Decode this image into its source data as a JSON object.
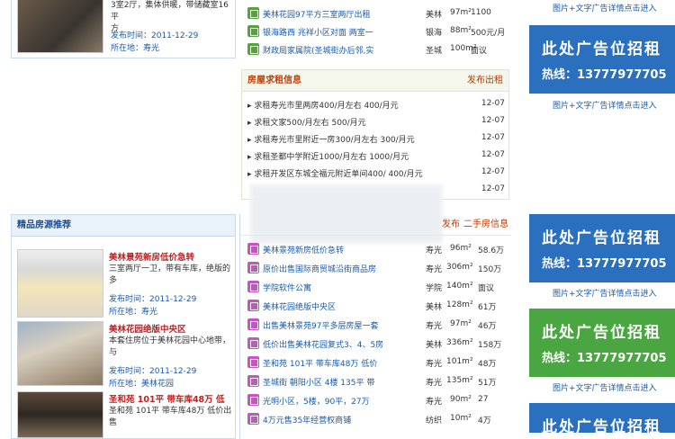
{
  "top_listing": {
    "desc": [
      "3室2厅，集体供暖，带储藏室16平",
      "方"
    ],
    "time": "发布时间：2011-12-29",
    "location": "所在地：寿光"
  },
  "top_rows": [
    {
      "title": "美林花园97平方三室两厅出租",
      "area": "美林",
      "size": "97m²",
      "price": "1100"
    },
    {
      "title": "银海路西 兆祥小区对面 两室一",
      "area": "银海",
      "size": "88m²",
      "price": "500元/月"
    },
    {
      "title": "财政局家属院(圣城街办后邻,实",
      "area": "圣城",
      "size": "100m²",
      "price": "面议"
    }
  ],
  "wanted": {
    "title": "房屋求租信息",
    "action": "发布出租",
    "items": [
      {
        "text": "求租寿光市里两房400/月左右 400/月元",
        "date": "12-07"
      },
      {
        "text": "求租文家500/月左右 500/月元",
        "date": "12-07"
      },
      {
        "text": "求租寿光市里附近一房300/月左右 300/月元",
        "date": "12-07"
      },
      {
        "text": "求租圣都中学附近1000/月左右 1000/月元",
        "date": "12-07"
      },
      {
        "text": "求租开发区东城全福元附近单间400/ 400/月元",
        "date": "12-07"
      },
      {
        "text": "",
        "date": "12-07"
      }
    ]
  },
  "featured": {
    "title": "精品房源推荐",
    "items": [
      {
        "title": "美林景苑新房低价急转",
        "desc": [
          "三室两厅一卫，带有车库，绝版的",
          "多"
        ],
        "time": "发布时间：2011-12-29",
        "location": "所在地：寿光"
      },
      {
        "title": "美林花园绝版中央区",
        "desc": [
          "本套住房位于美林花园中心地带，",
          "与"
        ],
        "time": "发布时间：2011-12-29",
        "location": "所在地：美林花园"
      },
      {
        "title": "圣和苑 101平 带车库48万 低",
        "desc": [
          "圣和苑 101平 带车库48万 低价出售"
        ]
      }
    ]
  },
  "sale": {
    "action": "发布",
    "title": "二手房信息",
    "rows": [
      {
        "title": "美林景苑新房低价急转",
        "area": "寿光",
        "size": "96m²",
        "price": "58.6万"
      },
      {
        "title": "原价出售国际商贸城沿街商品房",
        "area": "寿光",
        "size": "306m²",
        "price": "150万"
      },
      {
        "title": "学院软件公寓",
        "area": "学院",
        "size": "140m²",
        "price": "面议"
      },
      {
        "title": "美林花园绝版中央区",
        "area": "美林",
        "size": "128m²",
        "price": "61万"
      },
      {
        "title": "出售美林景苑97平多层房屋一套",
        "area": "寿光",
        "size": "97m²",
        "price": "46万"
      },
      {
        "title": "低价出售美林花园复式3、4、5房",
        "area": "美林",
        "size": "336m²",
        "price": "158万"
      },
      {
        "title": "圣和苑 101平 带车库48万 低价",
        "area": "寿光",
        "size": "101m²",
        "price": "48万"
      },
      {
        "title": "圣城街 朝阳小区 4楼 135平 带",
        "area": "寿光",
        "size": "135m²",
        "price": "51万"
      },
      {
        "title": "光明小区，5楼，90平，27万",
        "area": "寿光",
        "size": "90m²",
        "price": "27"
      },
      {
        "title": "4万元售35年经营权商铺",
        "area": "纺织",
        "size": "10m²",
        "price": "4万"
      }
    ]
  },
  "ads": [
    {
      "line1": "此处广告位招租",
      "line2": "热线：13777977705",
      "color": "#2b6fbf"
    },
    {
      "line1": "此处广告位招租",
      "line2": "热线：13777977705",
      "color": "#2b6fbf"
    },
    {
      "line1": "此处广告位招租",
      "line2": "热线：13777977705",
      "color": "#4aa640"
    },
    {
      "line1": "此处广告位招租",
      "line2": "",
      "color": "#2b6fbf"
    }
  ],
  "ad_link": "图片+文字广告详情点击进入"
}
